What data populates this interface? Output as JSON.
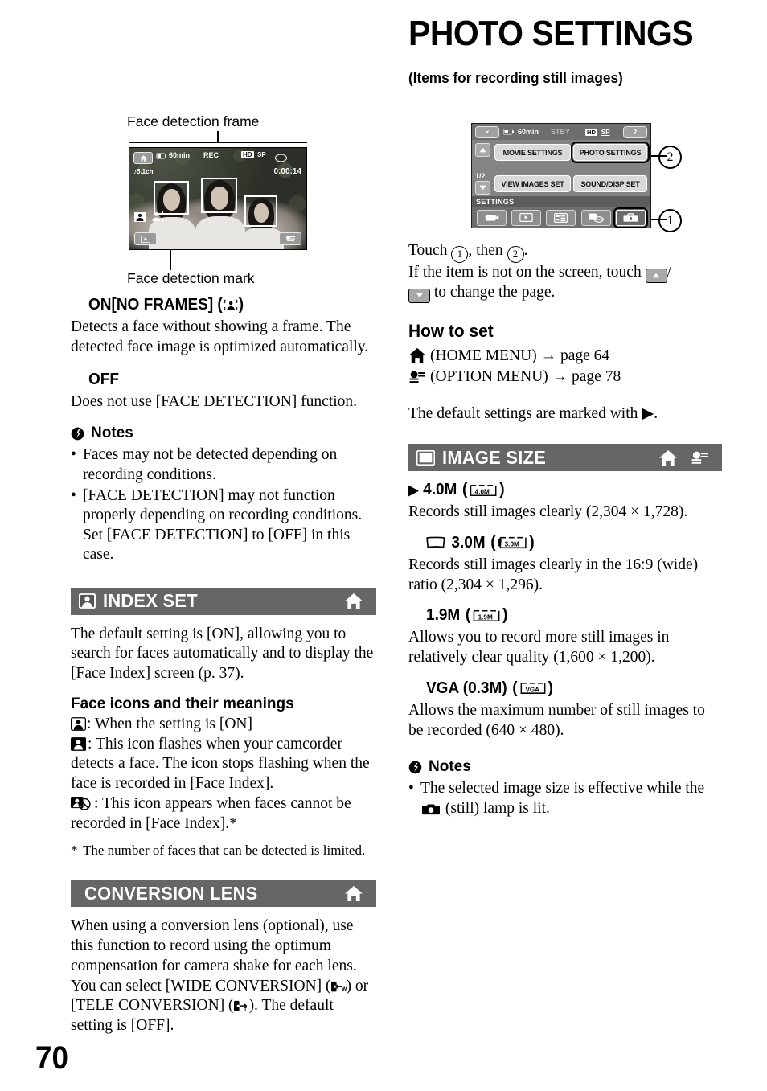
{
  "page": {
    "number": "70"
  },
  "header": {
    "title": "PHOTO SETTINGS",
    "subtitle": "(Items for recording still images)"
  },
  "figure_left": {
    "caption_top": "Face detection frame",
    "caption_bottom": "Face detection mark",
    "lcd": {
      "home_icon": "home-icon",
      "battery_time": "60min",
      "rec_status": "REC",
      "quality_hd": "HD",
      "quality_sp": "SP",
      "media_icon": "disc-icon",
      "audio": "5.1ch",
      "timecode": "0:00:14",
      "face_mark_icon": "face-detect-mark-icon",
      "play_icon": "play-review-icon",
      "option_icon": "option-menu-icon"
    }
  },
  "figure_right": {
    "status": {
      "close_label": "×",
      "battery_time": "60min",
      "standby": "STBY",
      "quality_hd": "HD",
      "quality_sp": "SP",
      "help_label": "?"
    },
    "page_indicator": "1/2",
    "items": [
      {
        "label": "MOVIE SETTINGS",
        "selected": false
      },
      {
        "label": "PHOTO SETTINGS",
        "selected": true
      },
      {
        "label": "VIEW IMAGES SET",
        "selected": false
      },
      {
        "label": "SOUND/DISP SET",
        "selected": false
      }
    ],
    "category_label": "SETTINGS",
    "tabs": [
      {
        "icon": "camera-tab-icon",
        "selected": false
      },
      {
        "icon": "playback-tab-icon",
        "selected": false
      },
      {
        "icon": "list-tab-icon",
        "selected": false
      },
      {
        "icon": "media-tab-icon",
        "selected": false
      },
      {
        "icon": "toolbox-tab-icon",
        "selected": true
      }
    ],
    "callouts": {
      "one": "1",
      "two": "2"
    }
  },
  "left_column": {
    "on_no_frames": {
      "heading_pre": "ON[NO FRAMES] (",
      "heading_icon": "face-detect-mark-icon",
      "heading_post": ")",
      "body": "Detects a face without showing a frame. The detected face image is optimized automatically."
    },
    "off": {
      "heading": "OFF",
      "body": "Does not use [FACE DETECTION] function."
    },
    "notes": {
      "label": "Notes",
      "items": [
        "Faces may not be detected depending on recording conditions.",
        "[FACE DETECTION] may not function properly depending on recording conditions. Set [FACE DETECTION] to [OFF] in this case."
      ]
    },
    "index_set": {
      "banner_title": "INDEX SET",
      "banner_left_icon": "face-index-icon",
      "banner_right_icons": [
        "home-icon"
      ],
      "body": "The default setting is [ON], allowing you to search for faces automatically and to display the [Face Index] screen (p. 37).",
      "sub_head": "Face icons and their meanings",
      "icon_meanings": [
        {
          "icon": "face-outline-icon",
          "text": ": When the setting is [ON]"
        },
        {
          "icon": "face-solid-icon",
          "text": ": This icon flashes when your camcorder detects a face. The icon stops flashing when the face is recorded in [Face Index]."
        },
        {
          "icon": "face-disabled-icon",
          "text": ": This icon appears when faces cannot be recorded in [Face Index].*"
        }
      ],
      "footnote": "The number of faces that can be detected is limited."
    },
    "conversion_lens": {
      "banner_title": "CONVERSION LENS",
      "banner_right_icons": [
        "home-icon"
      ],
      "body_1": "When using a conversion lens (optional), use this function to record using the optimum compensation for camera shake for each lens.",
      "body_2_pre": "You can select [WIDE CONVERSION] (",
      "body_2_mid": ") or [TELE CONVERSION] (",
      "body_2_post": "). The default setting is [OFF].",
      "wide_icon": "wide-conversion-icon",
      "tele_icon": "tele-conversion-icon"
    }
  },
  "right_column": {
    "touch_instruction_1_pre": "Touch ",
    "touch_instruction_1_mid": ", then ",
    "touch_instruction_1_post": ".",
    "touch_instruction_2_pre": "If the item is not on the screen, touch ",
    "touch_instruction_2_mid": "/",
    "touch_instruction_2_post": " to change the page.",
    "how_to_set": {
      "heading": "How to set",
      "rows": [
        {
          "icon": "home-icon",
          "text": "(HOME MENU)",
          "arrow": "→",
          "page": "page 64"
        },
        {
          "icon": "option-menu-icon",
          "text": "(OPTION MENU)",
          "arrow": "→",
          "page": "page 78"
        }
      ],
      "default_note_pre": "The default settings are marked with ",
      "default_note_post": "."
    },
    "image_size": {
      "banner_title": "IMAGE SIZE",
      "banner_left_icon": "image-size-icon",
      "banner_right_icons": [
        "home-icon",
        "option-menu-icon"
      ],
      "options": [
        {
          "marker": "▶",
          "label": "4.0M",
          "badge": "4.0M",
          "badge_wide": false,
          "prefix_icon": null,
          "body": "Records still images clearly (2,304 × 1,728)."
        },
        {
          "marker": "",
          "label": "3.0M",
          "badge": "3.0M",
          "badge_wide": true,
          "prefix_icon": "wide-ratio-icon",
          "body": "Records still images clearly in the 16:9 (wide) ratio (2,304 × 1,296)."
        },
        {
          "marker": "",
          "label": "1.9M",
          "badge": "1.9M",
          "badge_wide": false,
          "prefix_icon": null,
          "body": "Allows you to record more still images in relatively clear quality (1,600 × 1,200)."
        },
        {
          "marker": "",
          "label": "VGA (0.3M)",
          "badge": "VGA",
          "badge_wide": false,
          "prefix_icon": null,
          "body": "Allows the maximum number of still images to be recorded (640 × 480)."
        }
      ]
    },
    "notes": {
      "label": "Notes",
      "item_pre": "The selected image size is effective while the ",
      "item_icon": "still-camera-icon",
      "item_post": " (still) lamp is lit."
    }
  },
  "colors": {
    "banner_bg": "#666666",
    "text": "#000000",
    "lcd_bg": "#2a2a2a",
    "menu_bg": "#7a7a7a"
  }
}
